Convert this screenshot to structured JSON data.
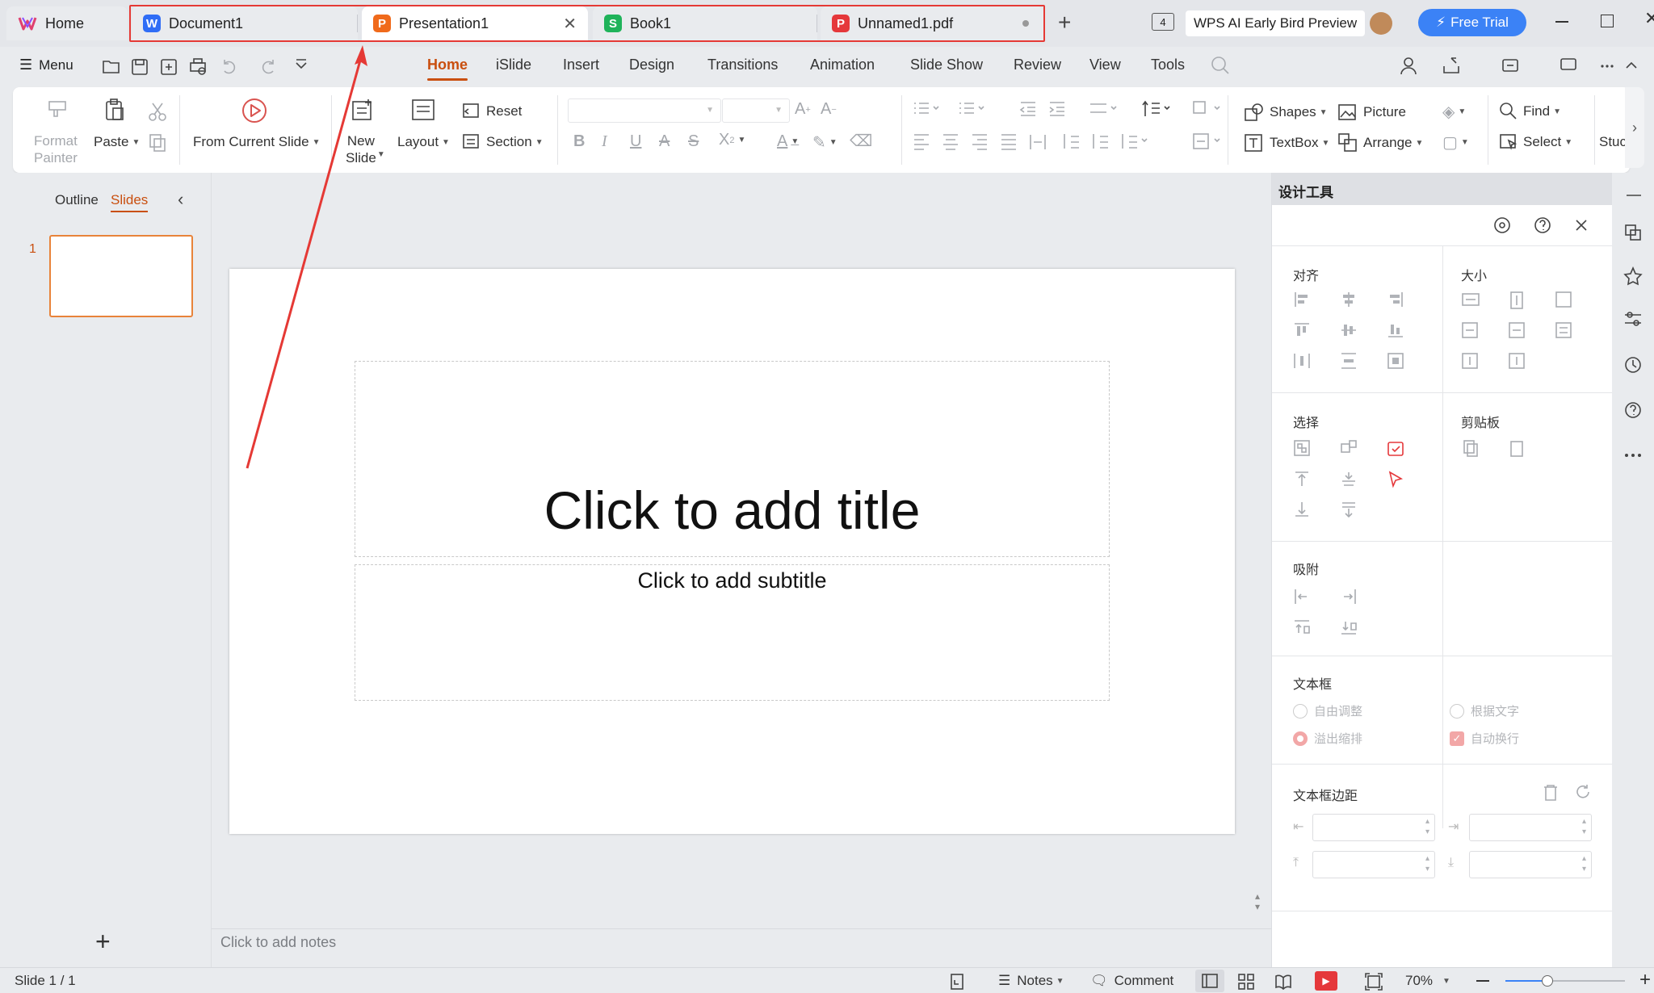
{
  "titlebar": {
    "home_label": "Home",
    "tabs": [
      {
        "label": "Document1",
        "icon": "writer-icon",
        "color": "#2f6df6"
      },
      {
        "label": "Presentation1",
        "icon": "presentation-icon",
        "color": "#f06a1b"
      },
      {
        "label": "Book1",
        "icon": "spreadsheet-icon",
        "color": "#1fb35a"
      },
      {
        "label": "Unnamed1.pdf",
        "icon": "pdf-icon",
        "color": "#e5383b"
      }
    ],
    "ai_preview": "WPS AI Early Bird Preview",
    "free_trial": "Free Trial",
    "window_badge": "4"
  },
  "menubar": {
    "menu_label": "Menu",
    "tabs": [
      "Home",
      "iSlide",
      "Insert",
      "Design",
      "Transitions",
      "Animation",
      "Slide Show",
      "Review",
      "View",
      "Tools"
    ],
    "active_tab": "Home"
  },
  "ribbon": {
    "format_painter": "Format\nPainter",
    "paste": "Paste",
    "from_current_slide": "From Current Slide",
    "new_slide": "New\nSlide",
    "layout": "Layout",
    "reset": "Reset",
    "section": "Section",
    "shapes": "Shapes",
    "picture": "Picture",
    "textbox": "TextBox",
    "arrange": "Arrange",
    "find": "Find",
    "select": "Select",
    "stuc": "Stuc"
  },
  "left_panel": {
    "outline_tab": "Outline",
    "slides_tab": "Slides",
    "slide_number": "1"
  },
  "slide": {
    "title_placeholder": "Click to add title",
    "subtitle_placeholder": "Click to add subtitle"
  },
  "notes_placeholder": "Click to add notes",
  "design_panel": {
    "title": "设计工具",
    "align": "对齐",
    "size": "大小",
    "select": "选择",
    "clipboard": "剪贴板",
    "snap": "吸附",
    "textbox": "文本框",
    "auto_adjust": "自由调整",
    "fit_text": "根据文字",
    "overflow_shrink": "溢出缩排",
    "auto_wrap": "自动换行",
    "textbox_margin": "文本框边距"
  },
  "statusbar": {
    "slide_info": "Slide 1 / 1",
    "notes": "Notes",
    "comment": "Comment",
    "zoom": "70%",
    "zoom_level": 0.35
  },
  "colors": {
    "accent": "#c94f0f",
    "highlight": "#e53935",
    "trial_button": "#3b82f6"
  }
}
